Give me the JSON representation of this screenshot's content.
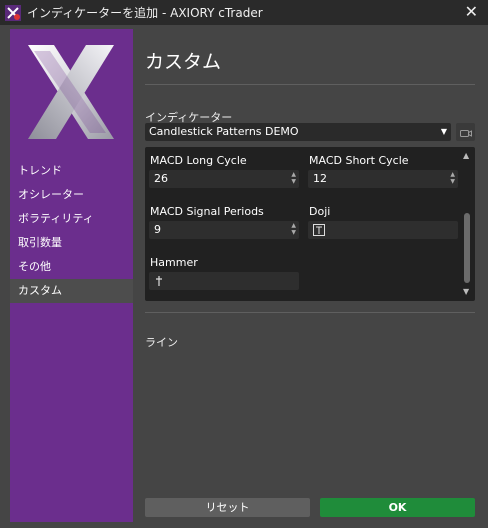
{
  "window": {
    "title": "インディケーターを追加 - AXIORY cTrader"
  },
  "sidebar": {
    "items": [
      {
        "label": "トレンド",
        "active": false
      },
      {
        "label": "オシレーター",
        "active": false
      },
      {
        "label": "ボラティリティ",
        "active": false
      },
      {
        "label": "取引数量",
        "active": false
      },
      {
        "label": "その他",
        "active": false
      },
      {
        "label": "カスタム",
        "active": true
      }
    ]
  },
  "main": {
    "heading": "カスタム",
    "indicator_label": "インディケーター",
    "indicator_selected": "Candlestick Patterns DEMO",
    "params": {
      "macd_long": {
        "label": "MACD Long Cycle",
        "value": "26"
      },
      "macd_short": {
        "label": "MACD Short Cycle",
        "value": "12"
      },
      "macd_signal": {
        "label": "MACD Signal Periods",
        "value": "9"
      },
      "doji": {
        "label": "Doji"
      },
      "hammer": {
        "label": "Hammer"
      }
    },
    "line_label": "ライン"
  },
  "footer": {
    "reset_label": "リセット",
    "ok_label": "OK"
  },
  "colors": {
    "sidebar": "#6b2e8d",
    "ok": "#1f8c3a",
    "reset": "#5f5f5f",
    "background": "#454545"
  }
}
